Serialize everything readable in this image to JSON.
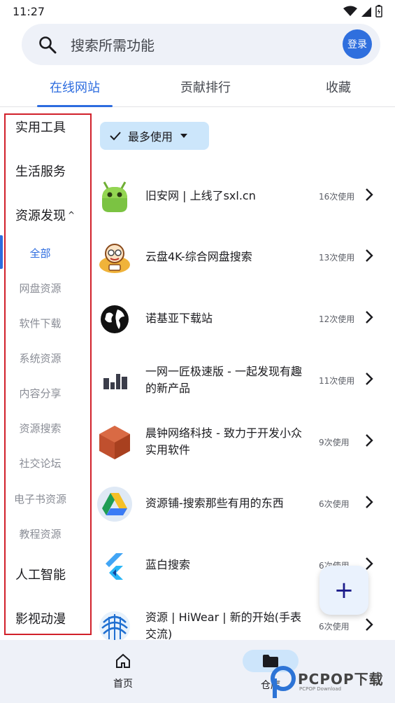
{
  "status_bar": {
    "time": "11:27"
  },
  "search": {
    "placeholder": "搜索所需功能",
    "login_label": "登录"
  },
  "tabs": [
    {
      "label": "在线网站",
      "active": true
    },
    {
      "label": "贡献排行",
      "active": false
    },
    {
      "label": "收藏",
      "active": false
    }
  ],
  "sidebar": {
    "categories": [
      "实用工具",
      "生活服务",
      "资源发现",
      "人工智能",
      "影视动漫"
    ],
    "expanded_marker": "^",
    "sub_items": [
      "全部",
      "网盘资源",
      "软件下载",
      "系统资源",
      "内容分享",
      "资源搜索",
      "社交论坛",
      "电子书资源",
      "教程资源"
    ],
    "active_sub": "全部"
  },
  "filter": {
    "label": "最多使用"
  },
  "items": [
    {
      "title": "旧安网 | 上线了sxl.cn",
      "count": "16次使用",
      "icon": "android-icon"
    },
    {
      "title": "云盘4K-综合网盘搜索",
      "count": "13次使用",
      "icon": "cartoon-icon"
    },
    {
      "title": "诺基亚下载站",
      "count": "12次使用",
      "icon": "globe-icon"
    },
    {
      "title": "一网一匠极速版 - 一起发现有趣的新产品",
      "count": "11次使用",
      "icon": "bars-logo-icon"
    },
    {
      "title": "晨钟网络科技 - 致力于开发小众实用软件",
      "count": "9次使用",
      "icon": "cube-icon"
    },
    {
      "title": "资源铺-搜索那些有用的东西",
      "count": "6次使用",
      "icon": "drive-icon"
    },
    {
      "title": "蓝白搜索",
      "count": "6次使用",
      "icon": "flutter-icon"
    },
    {
      "title": "资源 | HiWear | 新的开始(手表交流)",
      "count": "6次使用",
      "icon": "hiwear-icon"
    }
  ],
  "fab": {
    "label": "+"
  },
  "bottom_nav": {
    "home_label": "首页",
    "repo_label": "仓库"
  },
  "watermark": {
    "brand": "PCPOP下载",
    "sub": "PCPOP Download"
  },
  "colors": {
    "accent": "#2d6cdf",
    "chip": "#cce6fb",
    "highlight_frame": "#d1202a"
  }
}
